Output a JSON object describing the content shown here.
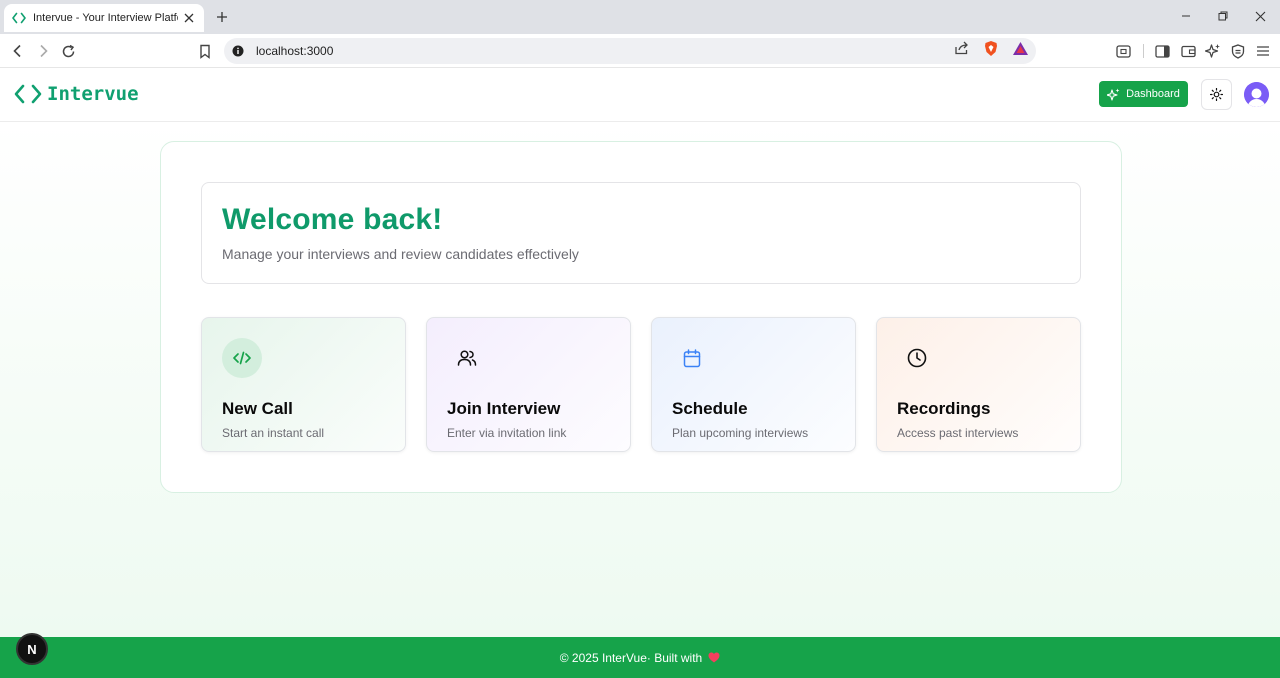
{
  "browser": {
    "tab_title": "Intervue - Your Interview Platform",
    "url": "localhost:3000",
    "favicon_icon": "code-brackets-icon"
  },
  "header": {
    "logo_text": "Intervue",
    "dashboard_label": "Dashboard",
    "theme_icon": "sun-icon",
    "brand_color": "#10a070",
    "accent_color": "#16a34a"
  },
  "welcome": {
    "title": "Welcome back!",
    "subtitle": "Manage your interviews and review candidates effectively"
  },
  "actions": [
    {
      "title": "New Call",
      "subtitle": "Start an instant call",
      "icon": "code-icon"
    },
    {
      "title": "Join Interview",
      "subtitle": "Enter via invitation link",
      "icon": "users-icon"
    },
    {
      "title": "Schedule",
      "subtitle": "Plan upcoming interviews",
      "icon": "calendar-icon"
    },
    {
      "title": "Recordings",
      "subtitle": "Access past interviews",
      "icon": "clock-icon"
    }
  ],
  "footer": {
    "text": "© 2025 InterVue· Built with",
    "heart_icon": "heart-icon"
  },
  "dev_badge": "N"
}
